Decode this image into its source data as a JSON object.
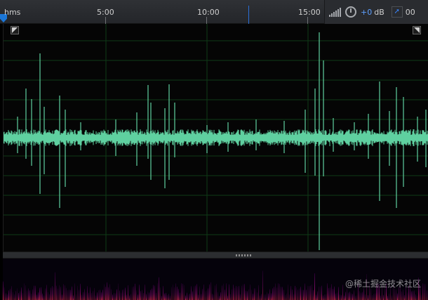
{
  "ruler": {
    "labels": [
      "hms",
      "5:00",
      "10:00",
      "15:00"
    ],
    "right_time": "00"
  },
  "controls": {
    "gain_value": "+0",
    "gain_unit": "dB"
  },
  "colors": {
    "waveform": "#5fd0a0",
    "grid": "#0f3a16",
    "playhead": "#1b76d6",
    "accent_blue": "#5ea0ff"
  },
  "icons": {
    "volume": "volume-bars-icon",
    "knob": "gain-knob-icon",
    "pin": "pin-icon"
  },
  "watermark": "@稀土掘金技术社区"
}
